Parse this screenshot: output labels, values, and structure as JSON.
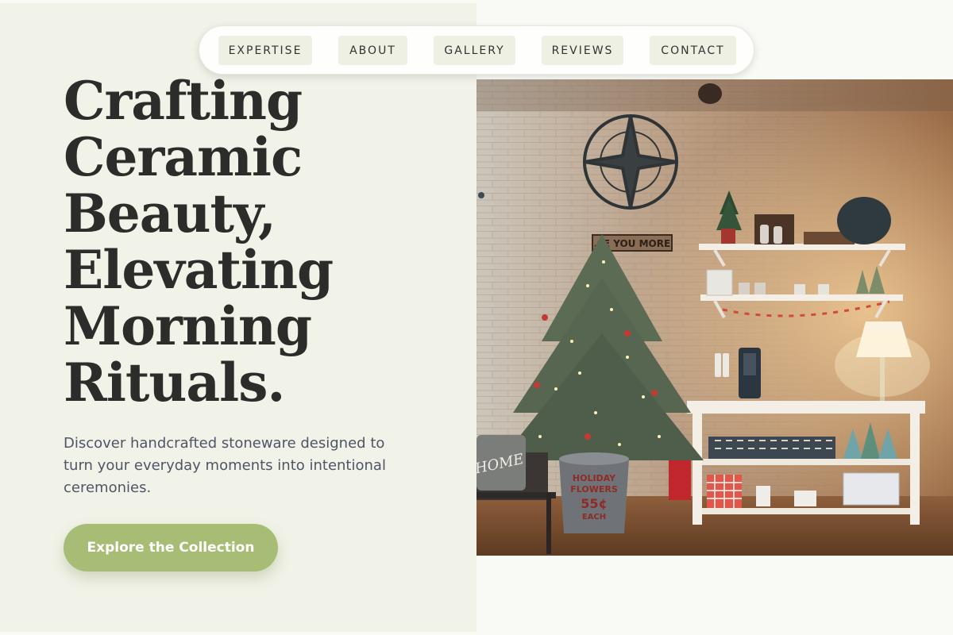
{
  "nav": {
    "items": [
      "EXPERTISE",
      "ABOUT",
      "GALLERY",
      "REVIEWS",
      "CONTACT"
    ]
  },
  "hero": {
    "headline_lines": [
      "Crafting",
      "Ceramic",
      "Beauty,",
      "Elevating",
      "Morning",
      "Rituals."
    ],
    "subtext": "Discover handcrafted stoneware designed to turn your everyday moments into intentional ceremonies.",
    "cta_label": "Explore the Collection"
  },
  "photo": {
    "sign_text": "…E YOU MORE",
    "bucket_lines": [
      "HOLIDAY",
      "FLOWERS",
      "55¢",
      "EACH"
    ],
    "pillow_text": "HOME"
  },
  "colors": {
    "left_panel": "#f1f2e8",
    "page_bg": "#f9f9f5",
    "headline": "#2c2c2a",
    "subtext": "#4f5566",
    "cta_bg": "#a7bd75",
    "nav_item_bg": "#eef0e3"
  }
}
